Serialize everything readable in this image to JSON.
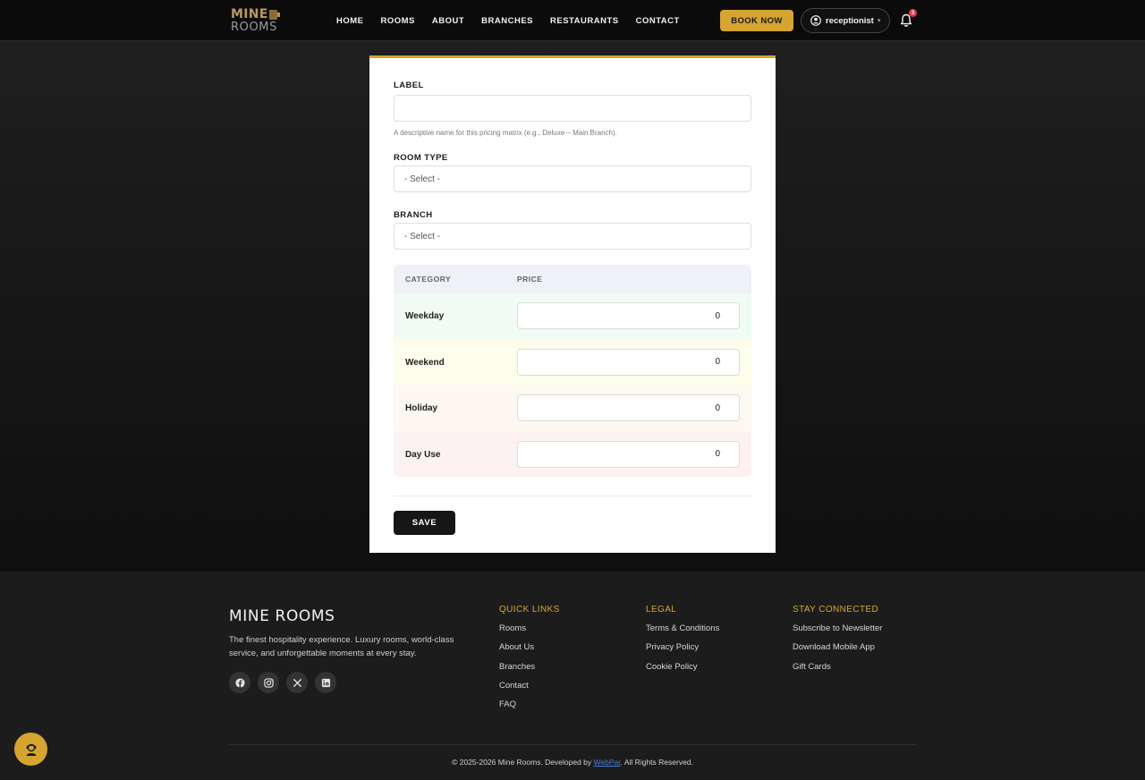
{
  "brand": {
    "logo_line1": "MINE",
    "logo_line2": "ROOMS"
  },
  "nav": {
    "links": [
      "HOME",
      "ROOMS",
      "ABOUT",
      "BRANCHES",
      "RESTAURANTS",
      "CONTACT"
    ],
    "book_label": "BOOK NOW",
    "user_name": "receptionist",
    "notification_count": "3"
  },
  "form": {
    "label_field": {
      "label": "LABEL",
      "value": "",
      "help": "A descriptive name for this pricing matrix (e.g., Deluxe – Main Branch)."
    },
    "room_type": {
      "label": "ROOM TYPE",
      "selected": "- Select -"
    },
    "branch": {
      "label": "BRANCH",
      "selected": "- Select -"
    },
    "pricing": {
      "header_category": "CATEGORY",
      "header_price": "PRICE",
      "rows": [
        {
          "category": "Weekday",
          "price": "0",
          "tint": "#effbf3"
        },
        {
          "category": "Weekend",
          "price": "0",
          "tint": "#fdfdec"
        },
        {
          "category": "Holiday",
          "price": "0",
          "tint": "#fdf8f0"
        },
        {
          "category": "Day Use",
          "price": "0",
          "tint": "#fdf1f1"
        }
      ]
    },
    "save_label": "SAVE"
  },
  "footer": {
    "brand": "MINE ROOMS",
    "tagline": "The finest hospitality experience. Luxury rooms, world-class service, and unforgettable moments at every stay.",
    "socials": [
      "facebook-icon",
      "instagram-icon",
      "x-icon",
      "linkedin-icon"
    ],
    "quick_links": {
      "title": "QUICK LINKS",
      "items": [
        "Rooms",
        "About Us",
        "Branches",
        "Contact",
        "FAQ"
      ]
    },
    "legal": {
      "title": "LEGAL",
      "items": [
        "Terms & Conditions",
        "Privacy Policy",
        "Cookie Policy"
      ]
    },
    "stay_connected": {
      "title": "STAY CONNECTED",
      "items": [
        "Subscribe to Newsletter",
        "Download Mobile App",
        "Gift Cards"
      ]
    },
    "copyright_prefix": "© 2025-2026 Mine Rooms. Developed by ",
    "developer": "WebPar",
    "copyright_suffix": ". All Rights Reserved."
  },
  "colors": {
    "accent": "#d6a531",
    "nav_bg": "#0b0b0b",
    "footer_bg": "#1c1c1c",
    "badge": "#e23b4b"
  }
}
